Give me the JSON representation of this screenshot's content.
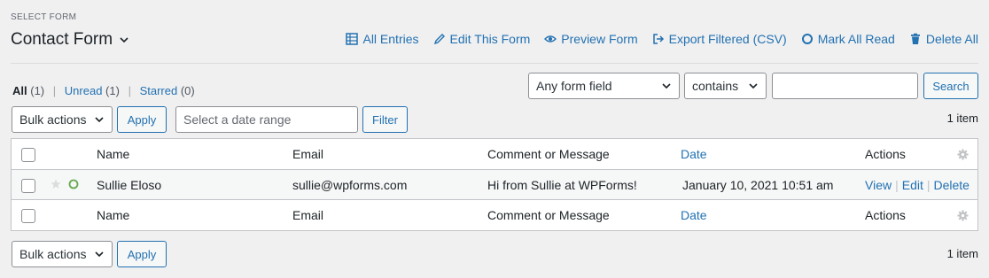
{
  "header": {
    "select_label": "SELECT FORM",
    "form_name": "Contact Form",
    "actions": [
      {
        "label": "All Entries",
        "icon": "table-icon"
      },
      {
        "label": "Edit This Form",
        "icon": "pencil-icon"
      },
      {
        "label": "Preview Form",
        "icon": "eye-icon"
      },
      {
        "label": "Export Filtered (CSV)",
        "icon": "export-icon"
      },
      {
        "label": "Mark All Read",
        "icon": "circle-icon"
      },
      {
        "label": "Delete All",
        "icon": "trash-icon"
      }
    ]
  },
  "views": {
    "all": {
      "label": "All",
      "count": "(1)"
    },
    "unread": {
      "label": "Unread",
      "count": "(1)"
    },
    "starred": {
      "label": "Starred",
      "count": "(0)"
    }
  },
  "search": {
    "field": "Any form field",
    "operator": "contains",
    "value": "",
    "button": "Search"
  },
  "top_nav": {
    "bulk_actions": "Bulk actions",
    "apply": "Apply",
    "date_placeholder": "Select a date range",
    "filter": "Filter",
    "item_count": "1 item"
  },
  "table": {
    "columns": {
      "name": "Name",
      "email": "Email",
      "message": "Comment or Message",
      "date": "Date",
      "actions": "Actions"
    },
    "rows": [
      {
        "name": "Sullie Eloso",
        "email": "sullie@wpforms.com",
        "message": "Hi from Sullie at WPForms!",
        "date": "January 10, 2021 10:51 am",
        "actions": {
          "view": "View",
          "edit": "Edit",
          "delete": "Delete"
        }
      }
    ]
  },
  "bottom_nav": {
    "bulk_actions": "Bulk actions",
    "apply": "Apply",
    "item_count": "1 item"
  },
  "colors": {
    "link": "#2271b1",
    "background": "#f0f0f1",
    "unread_dot": "#65a84c"
  }
}
